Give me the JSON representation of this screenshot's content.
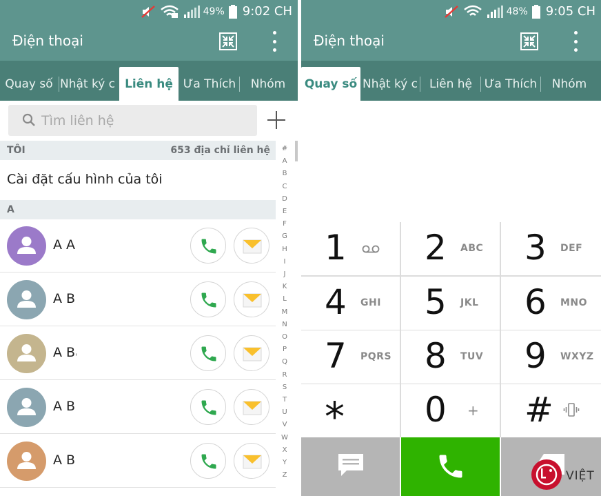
{
  "left": {
    "status_bar": {
      "battery": "49%",
      "time": "9:02 CH"
    },
    "app_title": "Điện thoại",
    "tabs": [
      {
        "label": "Quay số"
      },
      {
        "label": "Nhật ký c"
      },
      {
        "label": "Liên hệ",
        "active": true
      },
      {
        "label": "Ưa Thích"
      },
      {
        "label": "Nhóm"
      }
    ],
    "search": {
      "placeholder": "Tìm liên hệ",
      "value": ""
    },
    "me_section": {
      "label": "TÔI",
      "count": "653 địa chỉ liên hệ"
    },
    "profile_label": "Cài đặt cấu hình của tôi",
    "group_a": {
      "label": "A"
    },
    "contacts": [
      {
        "name": "A A",
        "avatar_color": "#9b7ac9"
      },
      {
        "name": "A B",
        "avatar_color": "#8ba6b1"
      },
      {
        "name": "A Ba",
        "avatar_color": "#c4b58e"
      },
      {
        "name": "A B",
        "avatar_color": "#8ba6b1"
      },
      {
        "name": "A B",
        "avatar_color": "#d59b6b"
      }
    ],
    "alphabet": [
      "#",
      "A",
      "B",
      "C",
      "D",
      "E",
      "F",
      "G",
      "H",
      "I",
      "J",
      "K",
      "L",
      "M",
      "N",
      "O",
      "P",
      "Q",
      "R",
      "S",
      "T",
      "U",
      "V",
      "W",
      "X",
      "Y",
      "Z"
    ]
  },
  "right": {
    "status_bar": {
      "battery": "48%",
      "time": "9:05 CH"
    },
    "app_title": "Điện thoại",
    "tabs": [
      {
        "label": "Quay số",
        "active": true
      },
      {
        "label": "Nhật ký c"
      },
      {
        "label": "Liên hệ"
      },
      {
        "label": "Ưa Thích"
      },
      {
        "label": "Nhóm"
      }
    ],
    "keypad": [
      {
        "digit": "1",
        "letters": "",
        "glyph": "voicemail-icon"
      },
      {
        "digit": "2",
        "letters": "ABC"
      },
      {
        "digit": "3",
        "letters": "DEF"
      },
      {
        "digit": "4",
        "letters": "GHI"
      },
      {
        "digit": "5",
        "letters": "JKL"
      },
      {
        "digit": "6",
        "letters": "MNO"
      },
      {
        "digit": "7",
        "letters": "PQRS"
      },
      {
        "digit": "8",
        "letters": "TUV"
      },
      {
        "digit": "9",
        "letters": "WXYZ"
      },
      {
        "digit": "*",
        "letters": ""
      },
      {
        "digit": "0",
        "letters": "+"
      },
      {
        "digit": "#",
        "letters": "",
        "glyph": "vibrate-icon"
      }
    ]
  },
  "watermark": {
    "brand": "LG",
    "text": "VIỆT"
  },
  "colors": {
    "teal": "#5e958e",
    "teal_dark": "#4a7f77",
    "call_green": "#2fb300",
    "msg_yellow": "#f9c02d"
  }
}
